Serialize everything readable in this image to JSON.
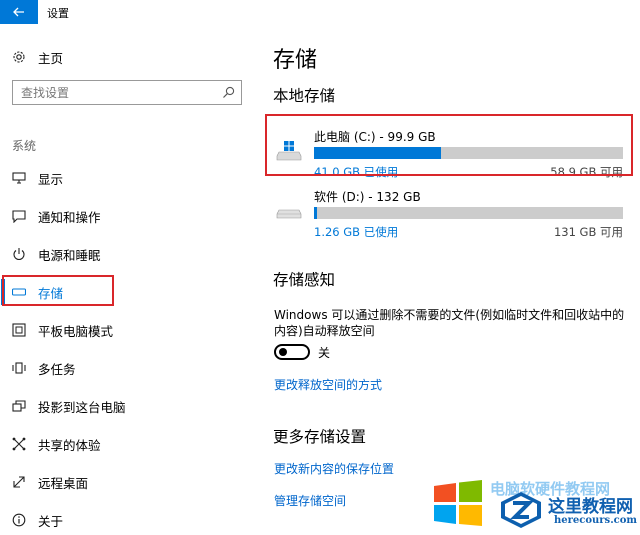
{
  "window": {
    "title": "设置"
  },
  "sidebar": {
    "home_label": "主页",
    "search_placeholder": "查找设置",
    "section_label": "系统",
    "items": [
      {
        "label": "显示",
        "icon": "display-icon"
      },
      {
        "label": "通知和操作",
        "icon": "notification-icon"
      },
      {
        "label": "电源和睡眠",
        "icon": "power-icon"
      },
      {
        "label": "存储",
        "icon": "storage-icon",
        "active": true
      },
      {
        "label": "平板电脑模式",
        "icon": "tablet-icon"
      },
      {
        "label": "多任务",
        "icon": "multitask-icon"
      },
      {
        "label": "投影到这台电脑",
        "icon": "project-icon"
      },
      {
        "label": "共享的体验",
        "icon": "share-icon"
      },
      {
        "label": "远程桌面",
        "icon": "remote-desktop-icon"
      },
      {
        "label": "关于",
        "icon": "info-icon"
      }
    ]
  },
  "main": {
    "title": "存储",
    "local_storage": {
      "heading": "本地存储",
      "drives": [
        {
          "name": "此电脑 (C:) - 99.9 GB",
          "used": "41.0 GB 已使用",
          "available": "58.9 GB 可用",
          "used_fraction": 0.41,
          "icon": "windows-drive-icon"
        },
        {
          "name": "软件 (D:) - 132 GB",
          "used": "1.26 GB 已使用",
          "available": "131 GB 可用",
          "used_fraction": 0.01,
          "icon": "drive-icon"
        }
      ]
    },
    "storage_sense": {
      "heading": "存储感知",
      "description": "Windows 可以通过删除不需要的文件(例如临时文件和回收站中的内容)自动释放空间",
      "toggle_state": "关",
      "toggle_on": false,
      "link": "更改释放空间的方式"
    },
    "more": {
      "heading": "更多存储设置",
      "links": [
        "更改新内容的保存位置",
        "管理存储空间"
      ]
    }
  },
  "watermark": {
    "faded_text": "电脑软硬件教程网",
    "brand": "这里教程网",
    "url": "herecours.com"
  },
  "colors": {
    "accent": "#0078d7",
    "highlight_box": "#d9262a",
    "bar_bg": "#cccccc"
  }
}
